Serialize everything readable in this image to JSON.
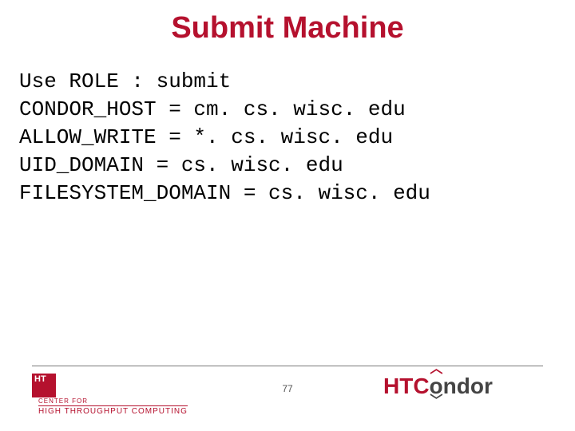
{
  "title": "Submit Machine",
  "config_lines": {
    "l0": "Use ROLE : submit",
    "l1": "CONDOR_HOST = cm. cs. wisc. edu",
    "l2": "ALLOW_WRITE = *. cs. wisc. edu",
    "l3": "UID_DOMAIN = cs. wisc. edu",
    "l4": "FILESYSTEM_DOMAIN = cs. wisc. edu"
  },
  "footer": {
    "page_number": "77",
    "logo_left": {
      "badge": "HT",
      "line1": "CENTER FOR",
      "line2": "HIGH THROUGHPUT COMPUTING"
    },
    "logo_right": {
      "part1": "HTC",
      "part2": "ndor",
      "wing": "︿",
      "wing2": "﹀"
    }
  }
}
